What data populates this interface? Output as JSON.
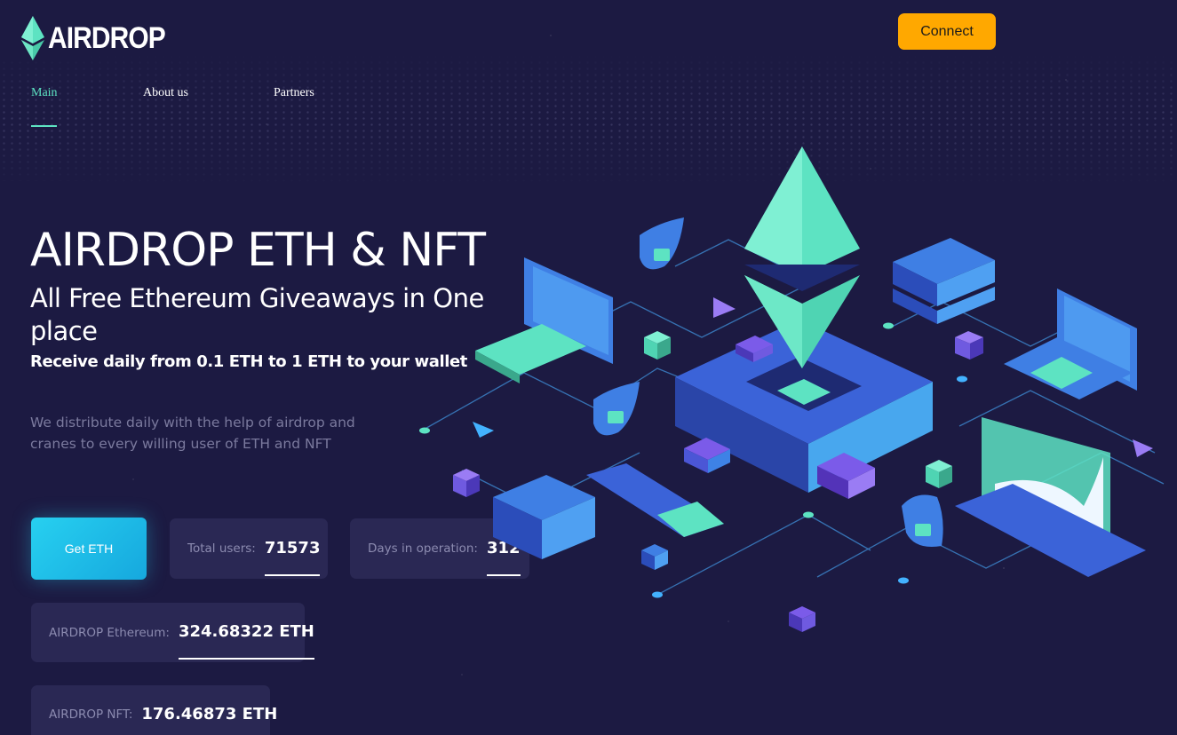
{
  "brand": {
    "name": "AIRDROP"
  },
  "header": {
    "connect_label": "Connect"
  },
  "nav": {
    "items": [
      {
        "label": "Main",
        "active": true
      },
      {
        "label": "About us",
        "active": false
      },
      {
        "label": "Partners",
        "active": false
      }
    ]
  },
  "hero": {
    "title": "AIRDROP ETH & NFT",
    "subtitle": "All Free Ethereum Giveaways in One place",
    "tagline": "Receive daily from 0.1 ETH to 1 ETH to your wallet",
    "description": "We distribute daily with the help of airdrop and cranes to every willing user of ETH and NFT"
  },
  "actions": {
    "get_eth_label": "Get ETH"
  },
  "stats": {
    "total_users": {
      "label": "Total users:",
      "value": "71573"
    },
    "days_in_operation": {
      "label": "Days in operation:",
      "value": "312"
    },
    "airdrop_ethereum": {
      "label": "AIRDROP Ethereum:",
      "value": "324.68322 ETH"
    },
    "airdrop_nft": {
      "label": "AIRDROP NFT:",
      "value": "176.46873 ETH"
    }
  },
  "colors": {
    "background": "#1c1a42",
    "accent_teal": "#5de3c2",
    "connect_orange": "#ffa800",
    "button_cyan": "#1fbce8",
    "card": "#2a2854"
  },
  "icons": {
    "logo": "ethereum-diamond-icon",
    "illustration": "isometric-ethereum-network-illustration"
  }
}
